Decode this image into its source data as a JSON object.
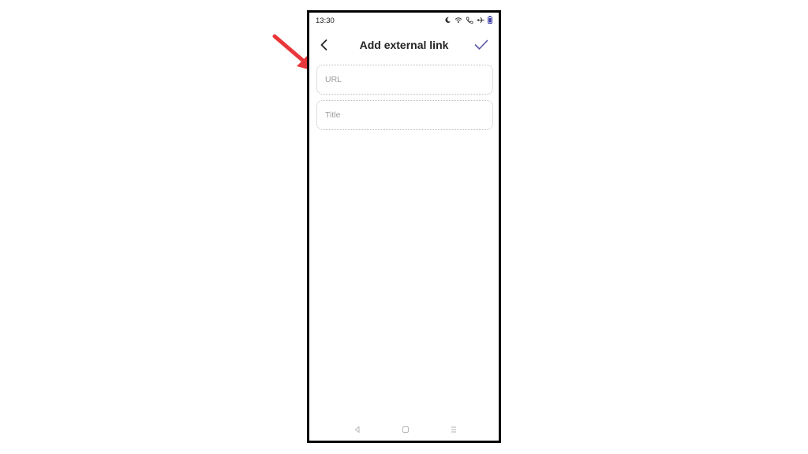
{
  "status_bar": {
    "time": "13:30",
    "icons": [
      "moon-icon",
      "wifi-icon",
      "call-icon",
      "airplane-icon",
      "battery-icon"
    ]
  },
  "header": {
    "title": "Add external link",
    "back_icon": "chevron-left-icon",
    "confirm_icon": "checkmark-icon"
  },
  "form": {
    "url": {
      "value": "",
      "placeholder": "URL"
    },
    "title": {
      "value": "",
      "placeholder": "Title"
    }
  },
  "nav_bar": {
    "icons": [
      "nav-back-icon",
      "nav-home-icon",
      "nav-recents-icon"
    ]
  },
  "colors": {
    "accent": "#5b57a6",
    "annotation_arrow": "#e8363a",
    "title_text": "#222222",
    "placeholder_text": "#9a9a9a"
  }
}
